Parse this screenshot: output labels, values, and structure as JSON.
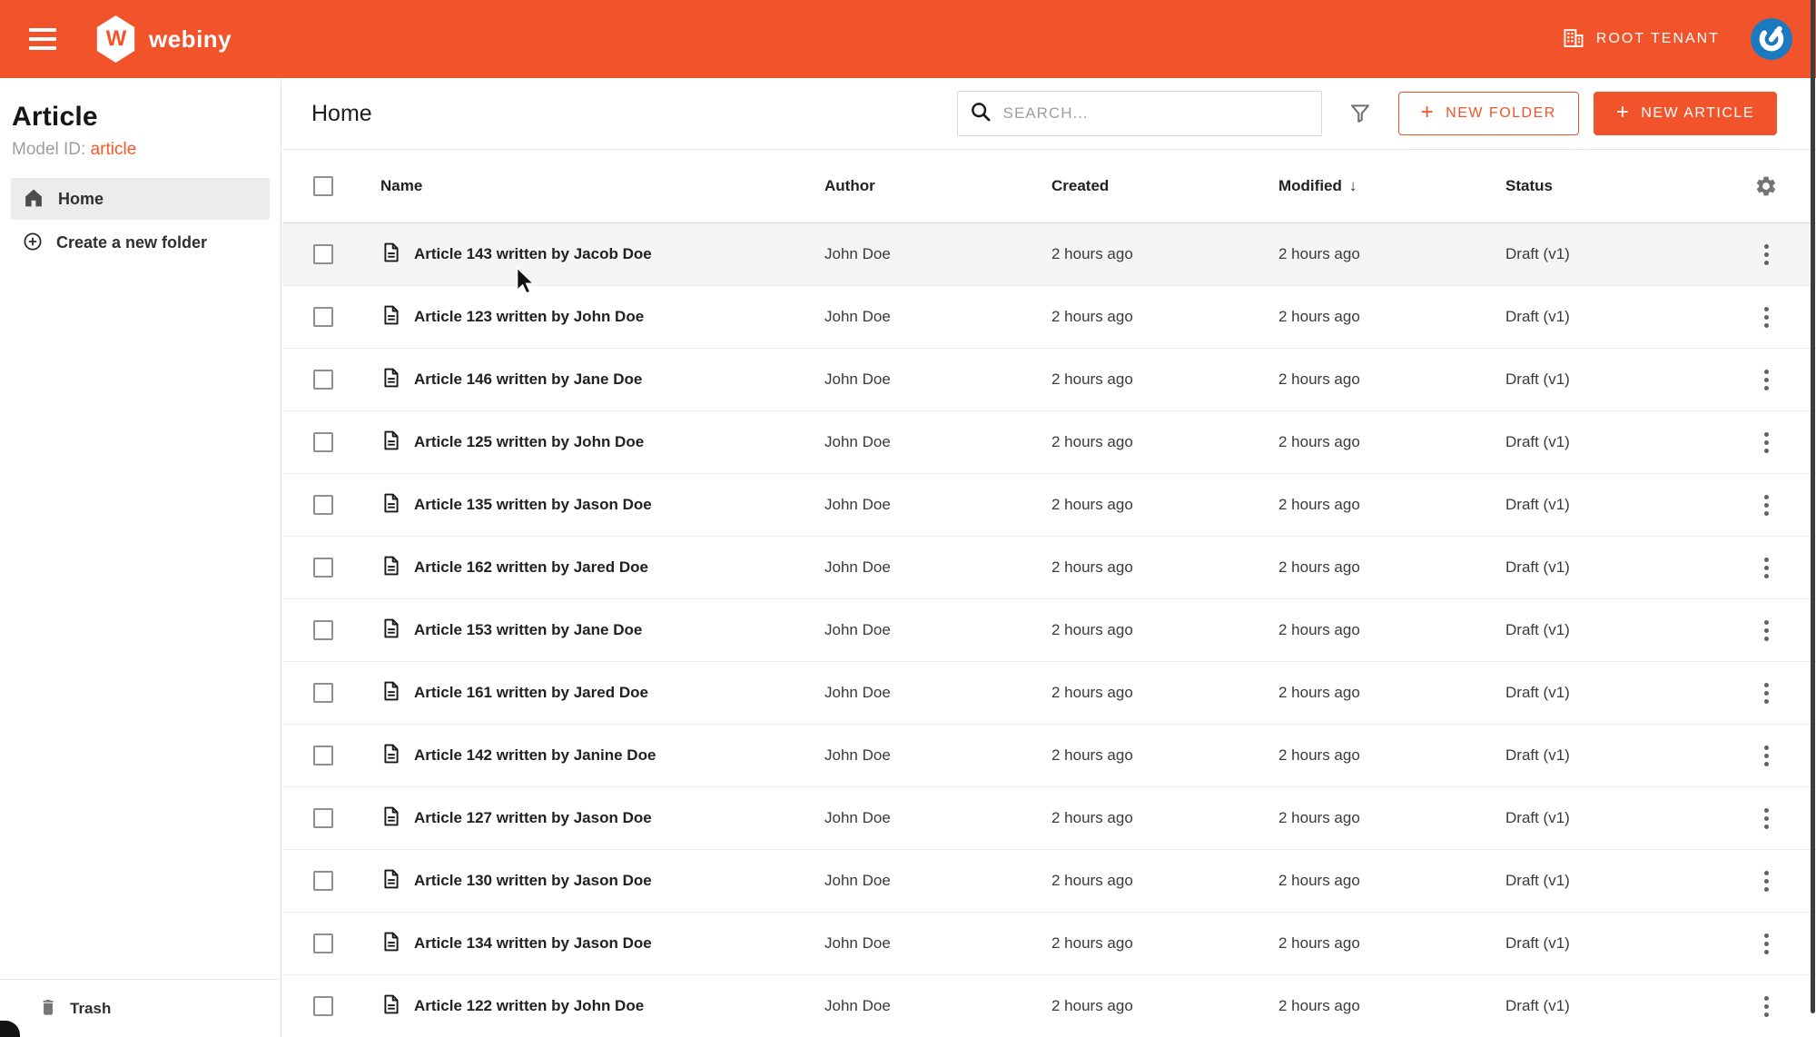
{
  "colors": {
    "primary": "#f1542b",
    "link_orange": "#fa5723",
    "avatar_blue": "#1b79c0"
  },
  "topbar": {
    "brand": "webiny",
    "brand_letter": "W",
    "tenant": "ROOT TENANT"
  },
  "sidebar": {
    "title": "Article",
    "model_id_label": "Model ID:",
    "model_id_value": "article",
    "nav": {
      "home": "Home",
      "create_folder": "Create a new folder"
    },
    "trash": "Trash"
  },
  "toolbar": {
    "title": "Home",
    "search_placeholder": "SEARCH...",
    "new_folder": "NEW FOLDER",
    "new_article": "NEW ARTICLE",
    "plus": "+"
  },
  "table": {
    "headers": {
      "name": "Name",
      "author": "Author",
      "created": "Created",
      "modified": "Modified",
      "status": "Status"
    },
    "sort": {
      "column": "Modified",
      "direction": "desc",
      "arrow": "↓"
    },
    "rows": [
      {
        "name": "Article 143 written by Jacob Doe",
        "author": "John Doe",
        "created": "2 hours ago",
        "modified": "2 hours ago",
        "status": "Draft (v1)"
      },
      {
        "name": "Article 123 written by John Doe",
        "author": "John Doe",
        "created": "2 hours ago",
        "modified": "2 hours ago",
        "status": "Draft (v1)"
      },
      {
        "name": "Article 146 written by Jane Doe",
        "author": "John Doe",
        "created": "2 hours ago",
        "modified": "2 hours ago",
        "status": "Draft (v1)"
      },
      {
        "name": "Article 125 written by John Doe",
        "author": "John Doe",
        "created": "2 hours ago",
        "modified": "2 hours ago",
        "status": "Draft (v1)"
      },
      {
        "name": "Article 135 written by Jason Doe",
        "author": "John Doe",
        "created": "2 hours ago",
        "modified": "2 hours ago",
        "status": "Draft (v1)"
      },
      {
        "name": "Article 162 written by Jared Doe",
        "author": "John Doe",
        "created": "2 hours ago",
        "modified": "2 hours ago",
        "status": "Draft (v1)"
      },
      {
        "name": "Article 153 written by Jane Doe",
        "author": "John Doe",
        "created": "2 hours ago",
        "modified": "2 hours ago",
        "status": "Draft (v1)"
      },
      {
        "name": "Article 161 written by Jared Doe",
        "author": "John Doe",
        "created": "2 hours ago",
        "modified": "2 hours ago",
        "status": "Draft (v1)"
      },
      {
        "name": "Article 142 written by Janine Doe",
        "author": "John Doe",
        "created": "2 hours ago",
        "modified": "2 hours ago",
        "status": "Draft (v1)"
      },
      {
        "name": "Article 127 written by Jason Doe",
        "author": "John Doe",
        "created": "2 hours ago",
        "modified": "2 hours ago",
        "status": "Draft (v1)"
      },
      {
        "name": "Article 130 written by Jason Doe",
        "author": "John Doe",
        "created": "2 hours ago",
        "modified": "2 hours ago",
        "status": "Draft (v1)"
      },
      {
        "name": "Article 134 written by Jason Doe",
        "author": "John Doe",
        "created": "2 hours ago",
        "modified": "2 hours ago",
        "status": "Draft (v1)"
      },
      {
        "name": "Article 122 written by John Doe",
        "author": "John Doe",
        "created": "2 hours ago",
        "modified": "2 hours ago",
        "status": "Draft (v1)"
      }
    ]
  }
}
